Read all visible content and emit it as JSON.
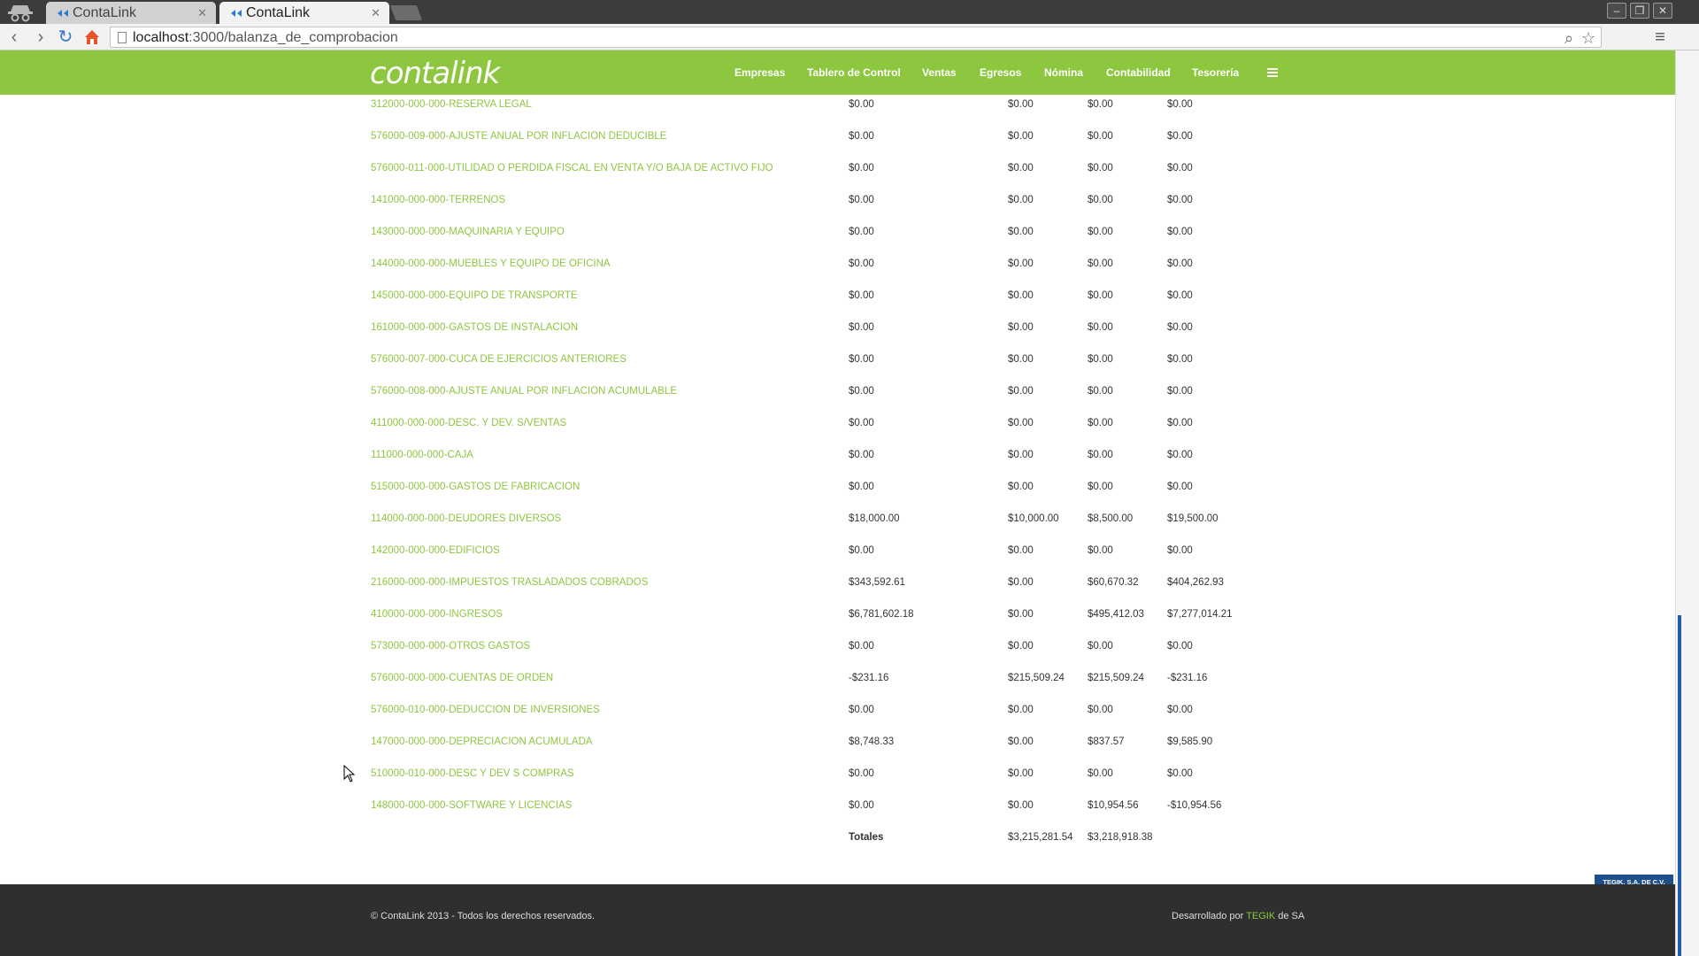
{
  "browser": {
    "tabs": [
      {
        "title": "ContaLink",
        "active": false
      },
      {
        "title": "ContaLink",
        "active": true
      }
    ],
    "url_host": "localhost",
    "url_path": ":3000/balanza_de_comprobacion",
    "icons": [
      "back-icon",
      "forward-icon",
      "reload-icon",
      "home-icon",
      "search-icon",
      "star-icon",
      "menu-icon"
    ]
  },
  "app": {
    "logo": "contalink",
    "nav": [
      "Empresas",
      "Tablero de Control",
      "Ventas",
      "Egresos",
      "Nómina",
      "Contabilidad",
      "Tesorería"
    ],
    "accent_color": "#8dc63f"
  },
  "rows": [
    {
      "account": "312000-000-000-RESERVA LEGAL",
      "c1": "$0.00",
      "c2": "$0.00",
      "c3": "$0.00",
      "c4": "$0.00"
    },
    {
      "account": "576000-009-000-AJUSTE ANUAL POR INFLACION DEDUCIBLE",
      "c1": "$0.00",
      "c2": "$0.00",
      "c3": "$0.00",
      "c4": "$0.00"
    },
    {
      "account": "576000-011-000-UTILIDAD O PERDIDA FISCAL EN VENTA Y/O BAJA DE ACTIVO FIJO",
      "c1": "$0.00",
      "c2": "$0.00",
      "c3": "$0.00",
      "c4": "$0.00"
    },
    {
      "account": "141000-000-000-TERRENOS",
      "c1": "$0.00",
      "c2": "$0.00",
      "c3": "$0.00",
      "c4": "$0.00"
    },
    {
      "account": "143000-000-000-MAQUINARIA Y EQUIPO",
      "c1": "$0.00",
      "c2": "$0.00",
      "c3": "$0.00",
      "c4": "$0.00"
    },
    {
      "account": "144000-000-000-MUEBLES Y EQUIPO DE OFICINA",
      "c1": "$0.00",
      "c2": "$0.00",
      "c3": "$0.00",
      "c4": "$0.00"
    },
    {
      "account": "145000-000-000-EQUIPO DE TRANSPORTE",
      "c1": "$0.00",
      "c2": "$0.00",
      "c3": "$0.00",
      "c4": "$0.00"
    },
    {
      "account": "161000-000-000-GASTOS DE INSTALACION",
      "c1": "$0.00",
      "c2": "$0.00",
      "c3": "$0.00",
      "c4": "$0.00"
    },
    {
      "account": "576000-007-000-CUCA DE EJERCICIOS ANTERIORES",
      "c1": "$0.00",
      "c2": "$0.00",
      "c3": "$0.00",
      "c4": "$0.00"
    },
    {
      "account": "576000-008-000-AJUSTE ANUAL POR INFLACION ACUMULABLE",
      "c1": "$0.00",
      "c2": "$0.00",
      "c3": "$0.00",
      "c4": "$0.00"
    },
    {
      "account": "411000-000-000-DESC. Y DEV. S/VENTAS",
      "c1": "$0.00",
      "c2": "$0.00",
      "c3": "$0.00",
      "c4": "$0.00"
    },
    {
      "account": "111000-000-000-CAJA",
      "c1": "$0.00",
      "c2": "$0.00",
      "c3": "$0.00",
      "c4": "$0.00"
    },
    {
      "account": "515000-000-000-GASTOS DE FABRICACION",
      "c1": "$0.00",
      "c2": "$0.00",
      "c3": "$0.00",
      "c4": "$0.00"
    },
    {
      "account": "114000-000-000-DEUDORES DIVERSOS",
      "c1": "$18,000.00",
      "c2": "$10,000.00",
      "c3": "$8,500.00",
      "c4": "$19,500.00"
    },
    {
      "account": "142000-000-000-EDIFICIOS",
      "c1": "$0.00",
      "c2": "$0.00",
      "c3": "$0.00",
      "c4": "$0.00"
    },
    {
      "account": "216000-000-000-IMPUESTOS TRASLADADOS COBRADOS",
      "c1": "$343,592.61",
      "c2": "$0.00",
      "c3": "$60,670.32",
      "c4": "$404,262.93"
    },
    {
      "account": "410000-000-000-INGRESOS",
      "c1": "$6,781,602.18",
      "c2": "$0.00",
      "c3": "$495,412.03",
      "c4": "$7,277,014.21"
    },
    {
      "account": "573000-000-000-OTROS GASTOS",
      "c1": "$0.00",
      "c2": "$0.00",
      "c3": "$0.00",
      "c4": "$0.00"
    },
    {
      "account": "576000-000-000-CUENTAS DE ORDEN",
      "c1": "-$231.16",
      "c2": "$215,509.24",
      "c3": "$215,509.24",
      "c4": "-$231.16"
    },
    {
      "account": "576000-010-000-DEDUCCION DE INVERSIONES",
      "c1": "$0.00",
      "c2": "$0.00",
      "c3": "$0.00",
      "c4": "$0.00"
    },
    {
      "account": "147000-000-000-DEPRECIACION ACUMULADA",
      "c1": "$8,748.33",
      "c2": "$0.00",
      "c3": "$837.57",
      "c4": "$9,585.90"
    },
    {
      "account": "510000-010-000-DESC Y DEV S COMPRAS",
      "c1": "$0.00",
      "c2": "$0.00",
      "c3": "$0.00",
      "c4": "$0.00"
    },
    {
      "account": "148000-000-000-SOFTWARE Y LICENCIAS",
      "c1": "$0.00",
      "c2": "$0.00",
      "c3": "$10,954.56",
      "c4": "-$10,954.56"
    }
  ],
  "totals": {
    "label": "Totales",
    "c2": "$3,215,281.54",
    "c3": "$3,218,918.38"
  },
  "badge": "TEGIK, S.A. DE C.V.",
  "footer": {
    "left": "© ContaLink 2013 - Todos los derechos reservados.",
    "right_prefix": "Desarrollado por",
    "right_link": "TEGIK",
    "right_suffix": "de SA"
  }
}
